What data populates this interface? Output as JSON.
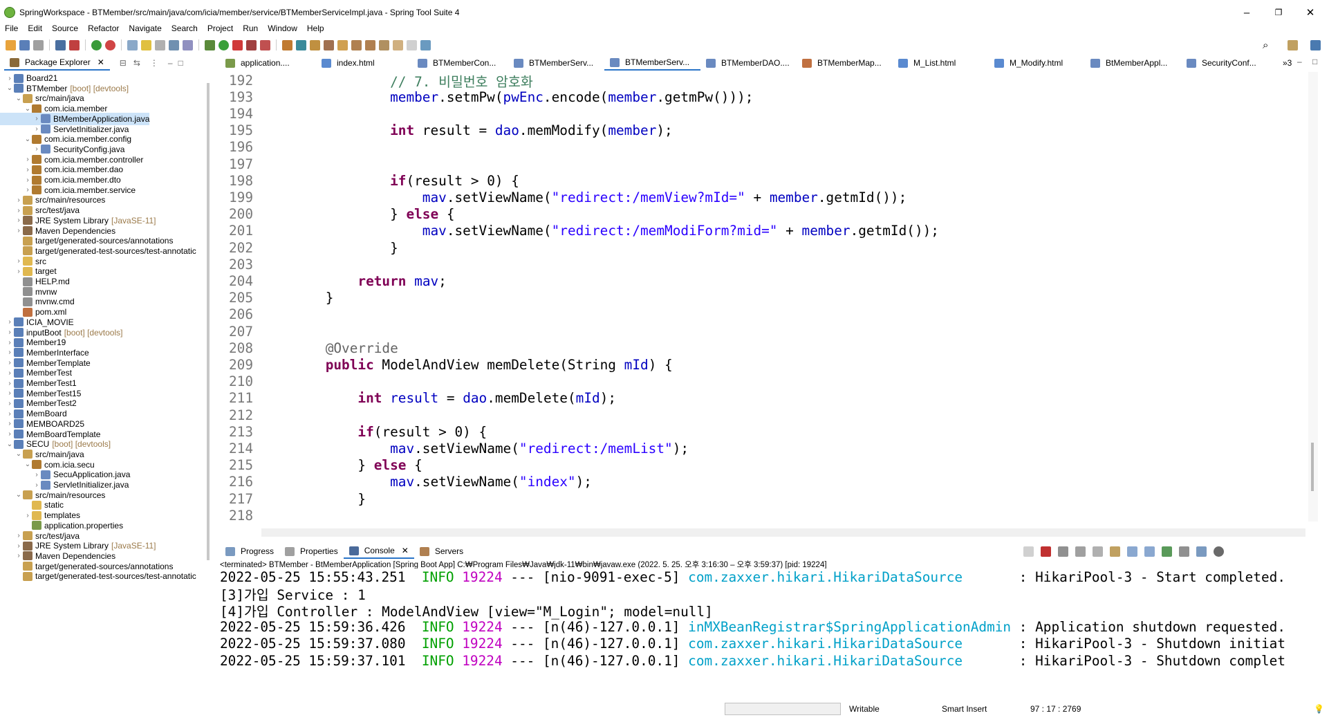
{
  "window": {
    "title": "SpringWorkspace - BTMember/src/main/java/com/icia/member/service/BTMemberServiceImpl.java - Spring Tool Suite 4",
    "minimize": "–",
    "maximize": "❐",
    "close": "✕"
  },
  "menu": [
    "File",
    "Edit",
    "Source",
    "Refactor",
    "Navigate",
    "Search",
    "Project",
    "Run",
    "Window",
    "Help"
  ],
  "package_explorer": {
    "tab_label": "Package Explorer",
    "items": [
      {
        "label": "Board21",
        "dec": "",
        "depth": 0,
        "arrow": "›",
        "icon": "project"
      },
      {
        "label": "BTMember",
        "dec": "[boot] [devtools]",
        "depth": 0,
        "arrow": "⌄",
        "icon": "project"
      },
      {
        "label": "src/main/java",
        "dec": "",
        "depth": 1,
        "arrow": "⌄",
        "icon": "srcfolder"
      },
      {
        "label": "com.icia.member",
        "dec": "",
        "depth": 2,
        "arrow": "⌄",
        "icon": "package"
      },
      {
        "label": "BtMemberApplication.java",
        "dec": "",
        "depth": 3,
        "arrow": "›",
        "icon": "java",
        "selected": true
      },
      {
        "label": "ServletInitializer.java",
        "dec": "",
        "depth": 3,
        "arrow": "›",
        "icon": "java"
      },
      {
        "label": "com.icia.member.config",
        "dec": "",
        "depth": 2,
        "arrow": "⌄",
        "icon": "package"
      },
      {
        "label": "SecurityConfig.java",
        "dec": "",
        "depth": 3,
        "arrow": "›",
        "icon": "java"
      },
      {
        "label": "com.icia.member.controller",
        "dec": "",
        "depth": 2,
        "arrow": "›",
        "icon": "package"
      },
      {
        "label": "com.icia.member.dao",
        "dec": "",
        "depth": 2,
        "arrow": "›",
        "icon": "package"
      },
      {
        "label": "com.icia.member.dto",
        "dec": "",
        "depth": 2,
        "arrow": "›",
        "icon": "package"
      },
      {
        "label": "com.icia.member.service",
        "dec": "",
        "depth": 2,
        "arrow": "›",
        "icon": "package"
      },
      {
        "label": "src/main/resources",
        "dec": "",
        "depth": 1,
        "arrow": "›",
        "icon": "srcfolder"
      },
      {
        "label": "src/test/java",
        "dec": "",
        "depth": 1,
        "arrow": "›",
        "icon": "srcfolder"
      },
      {
        "label": "JRE System Library",
        "dec": "[JavaSE-11]",
        "depth": 1,
        "arrow": "›",
        "icon": "lib"
      },
      {
        "label": "Maven Dependencies",
        "dec": "",
        "depth": 1,
        "arrow": "›",
        "icon": "lib"
      },
      {
        "label": "target/generated-sources/annotations",
        "dec": "",
        "depth": 1,
        "arrow": "",
        "icon": "srcfolder"
      },
      {
        "label": "target/generated-test-sources/test-annotatic",
        "dec": "",
        "depth": 1,
        "arrow": "",
        "icon": "srcfolder"
      },
      {
        "label": "src",
        "dec": "",
        "depth": 1,
        "arrow": "›",
        "icon": "folder"
      },
      {
        "label": "target",
        "dec": "",
        "depth": 1,
        "arrow": "›",
        "icon": "folder"
      },
      {
        "label": "HELP.md",
        "dec": "",
        "depth": 1,
        "arrow": "",
        "icon": "file"
      },
      {
        "label": "mvnw",
        "dec": "",
        "depth": 1,
        "arrow": "",
        "icon": "file"
      },
      {
        "label": "mvnw.cmd",
        "dec": "",
        "depth": 1,
        "arrow": "",
        "icon": "file"
      },
      {
        "label": "pom.xml",
        "dec": "",
        "depth": 1,
        "arrow": "",
        "icon": "xml"
      },
      {
        "label": "ICIA_MOVIE",
        "dec": "",
        "depth": 0,
        "arrow": "›",
        "icon": "project"
      },
      {
        "label": "inputBoot",
        "dec": "[boot] [devtools]",
        "depth": 0,
        "arrow": "›",
        "icon": "project"
      },
      {
        "label": "Member19",
        "dec": "",
        "depth": 0,
        "arrow": "›",
        "icon": "project"
      },
      {
        "label": "MemberInterface",
        "dec": "",
        "depth": 0,
        "arrow": "›",
        "icon": "project"
      },
      {
        "label": "MemberTemplate",
        "dec": "",
        "depth": 0,
        "arrow": "›",
        "icon": "project"
      },
      {
        "label": "MemberTest",
        "dec": "",
        "depth": 0,
        "arrow": "›",
        "icon": "project"
      },
      {
        "label": "MemberTest1",
        "dec": "",
        "depth": 0,
        "arrow": "›",
        "icon": "project"
      },
      {
        "label": "MemberTest15",
        "dec": "",
        "depth": 0,
        "arrow": "›",
        "icon": "project"
      },
      {
        "label": "MemberTest2",
        "dec": "",
        "depth": 0,
        "arrow": "›",
        "icon": "project"
      },
      {
        "label": "MemBoard",
        "dec": "",
        "depth": 0,
        "arrow": "›",
        "icon": "project"
      },
      {
        "label": "MEMBOARD25",
        "dec": "",
        "depth": 0,
        "arrow": "›",
        "icon": "project"
      },
      {
        "label": "MemBoardTemplate",
        "dec": "",
        "depth": 0,
        "arrow": "›",
        "icon": "project"
      },
      {
        "label": "SECU",
        "dec": "[boot] [devtools]",
        "depth": 0,
        "arrow": "⌄",
        "icon": "project"
      },
      {
        "label": "src/main/java",
        "dec": "",
        "depth": 1,
        "arrow": "⌄",
        "icon": "srcfolder"
      },
      {
        "label": "com.icia.secu",
        "dec": "",
        "depth": 2,
        "arrow": "⌄",
        "icon": "package"
      },
      {
        "label": "SecuApplication.java",
        "dec": "",
        "depth": 3,
        "arrow": "›",
        "icon": "java"
      },
      {
        "label": "ServletInitializer.java",
        "dec": "",
        "depth": 3,
        "arrow": "›",
        "icon": "java"
      },
      {
        "label": "src/main/resources",
        "dec": "",
        "depth": 1,
        "arrow": "⌄",
        "icon": "srcfolder"
      },
      {
        "label": "static",
        "dec": "",
        "depth": 2,
        "arrow": "",
        "icon": "folder"
      },
      {
        "label": "templates",
        "dec": "",
        "depth": 2,
        "arrow": "›",
        "icon": "folder"
      },
      {
        "label": "application.properties",
        "dec": "",
        "depth": 2,
        "arrow": "",
        "icon": "props"
      },
      {
        "label": "src/test/java",
        "dec": "",
        "depth": 1,
        "arrow": "›",
        "icon": "srcfolder"
      },
      {
        "label": "JRE System Library",
        "dec": "[JavaSE-11]",
        "depth": 1,
        "arrow": "›",
        "icon": "lib"
      },
      {
        "label": "Maven Dependencies",
        "dec": "",
        "depth": 1,
        "arrow": "›",
        "icon": "lib"
      },
      {
        "label": "target/generated-sources/annotations",
        "dec": "",
        "depth": 1,
        "arrow": "",
        "icon": "srcfolder"
      },
      {
        "label": "target/generated-test-sources/test-annotatic",
        "dec": "",
        "depth": 1,
        "arrow": "",
        "icon": "srcfolder"
      }
    ]
  },
  "editor_tabs": [
    {
      "label": "application....",
      "icon": "props"
    },
    {
      "label": "index.html",
      "icon": "html"
    },
    {
      "label": "BTMemberCon...",
      "icon": "java"
    },
    {
      "label": "BTMemberServ...",
      "icon": "java"
    },
    {
      "label": "BTMemberServ...",
      "icon": "java",
      "active": true
    },
    {
      "label": "BTMemberDAO....",
      "icon": "java"
    },
    {
      "label": "BTMemberMap...",
      "icon": "xml"
    },
    {
      "label": "M_List.html",
      "icon": "html"
    },
    {
      "label": "M_Modify.html",
      "icon": "html"
    },
    {
      "label": "BtMemberAppl...",
      "icon": "java"
    },
    {
      "label": "SecurityConf...",
      "icon": "java"
    },
    {
      "label": "»3",
      "icon": ""
    }
  ],
  "code": [
    {
      "n": "192",
      "segs": [
        [
          "            ",
          ""
        ],
        [
          "// 7. 비밀번호 암호화",
          "cmt"
        ]
      ]
    },
    {
      "n": "193",
      "segs": [
        [
          "            ",
          ""
        ],
        [
          "member",
          "fld"
        ],
        [
          ".setmPw(",
          ""
        ],
        [
          "pwEnc",
          "fld"
        ],
        [
          ".encode(",
          ""
        ],
        [
          "member",
          "fld"
        ],
        [
          ".getmPw()));",
          ""
        ]
      ]
    },
    {
      "n": "194",
      "segs": []
    },
    {
      "n": "195",
      "segs": [
        [
          "            ",
          ""
        ],
        [
          "int",
          "kw"
        ],
        [
          " result = ",
          ""
        ],
        [
          "dao",
          "fld"
        ],
        [
          ".memModify(",
          ""
        ],
        [
          "member",
          "fld"
        ],
        [
          ");",
          ""
        ]
      ]
    },
    {
      "n": "196",
      "segs": []
    },
    {
      "n": "197",
      "segs": []
    },
    {
      "n": "198",
      "segs": [
        [
          "            ",
          ""
        ],
        [
          "if",
          "kw"
        ],
        [
          "(result > 0) {",
          ""
        ]
      ]
    },
    {
      "n": "199",
      "segs": [
        [
          "                ",
          ""
        ],
        [
          "mav",
          "fld"
        ],
        [
          ".setViewName(",
          ""
        ],
        [
          "\"redirect:/memView?mId=\"",
          "str"
        ],
        [
          " + ",
          ""
        ],
        [
          "member",
          "fld"
        ],
        [
          ".getmId());",
          ""
        ]
      ]
    },
    {
      "n": "200",
      "segs": [
        [
          "            } ",
          ""
        ],
        [
          "else",
          "kw"
        ],
        [
          " {",
          ""
        ]
      ]
    },
    {
      "n": "201",
      "segs": [
        [
          "                ",
          ""
        ],
        [
          "mav",
          "fld"
        ],
        [
          ".setViewName(",
          ""
        ],
        [
          "\"redirect:/memModiForm?mid=\"",
          "str"
        ],
        [
          " + ",
          ""
        ],
        [
          "member",
          "fld"
        ],
        [
          ".getmId());",
          ""
        ]
      ]
    },
    {
      "n": "202",
      "segs": [
        [
          "            }",
          ""
        ]
      ]
    },
    {
      "n": "203",
      "segs": []
    },
    {
      "n": "204",
      "segs": [
        [
          "        ",
          ""
        ],
        [
          "return",
          "kw"
        ],
        [
          " ",
          ""
        ],
        [
          "mav",
          "fld"
        ],
        [
          ";",
          ""
        ]
      ]
    },
    {
      "n": "205",
      "segs": [
        [
          "    }",
          ""
        ]
      ]
    },
    {
      "n": "206",
      "segs": []
    },
    {
      "n": "207",
      "segs": []
    },
    {
      "n": "208",
      "segs": [
        [
          "    ",
          ""
        ],
        [
          "@Override",
          "ann"
        ]
      ]
    },
    {
      "n": "209",
      "segs": [
        [
          "    ",
          ""
        ],
        [
          "public",
          "kw"
        ],
        [
          " ModelAndView memDelete(String ",
          ""
        ],
        [
          "mId",
          "fld"
        ],
        [
          ") {",
          ""
        ]
      ]
    },
    {
      "n": "210",
      "segs": []
    },
    {
      "n": "211",
      "segs": [
        [
          "        ",
          ""
        ],
        [
          "int",
          "kw"
        ],
        [
          " ",
          ""
        ],
        [
          "result",
          "fld"
        ],
        [
          " = ",
          ""
        ],
        [
          "dao",
          "fld"
        ],
        [
          ".memDelete(",
          ""
        ],
        [
          "mId",
          "fld"
        ],
        [
          ");",
          ""
        ]
      ]
    },
    {
      "n": "212",
      "segs": []
    },
    {
      "n": "213",
      "segs": [
        [
          "        ",
          ""
        ],
        [
          "if",
          "kw"
        ],
        [
          "(result > 0) {",
          ""
        ]
      ]
    },
    {
      "n": "214",
      "segs": [
        [
          "            ",
          ""
        ],
        [
          "mav",
          "fld"
        ],
        [
          ".setViewName(",
          ""
        ],
        [
          "\"redirect:/memList\"",
          "str"
        ],
        [
          ");",
          ""
        ]
      ]
    },
    {
      "n": "215",
      "segs": [
        [
          "        } ",
          ""
        ],
        [
          "else",
          "kw"
        ],
        [
          " {",
          ""
        ]
      ]
    },
    {
      "n": "216",
      "segs": [
        [
          "            ",
          ""
        ],
        [
          "mav",
          "fld"
        ],
        [
          ".setViewName(",
          ""
        ],
        [
          "\"index\"",
          "str"
        ],
        [
          ");",
          ""
        ]
      ]
    },
    {
      "n": "217",
      "segs": [
        [
          "        }",
          ""
        ]
      ]
    },
    {
      "n": "218",
      "segs": []
    }
  ],
  "bottom_tabs": [
    "Progress",
    "Properties",
    "Console",
    "Servers"
  ],
  "console": {
    "header": "<terminated> BTMember - BtMemberApplication [Spring Boot App] C:₩Program Files₩Java₩jdk-11₩bin₩javaw.exe  (2022. 5. 25. 오후 3:16:30 – 오후 3:59:37) [pid: 19224]",
    "lines": [
      [
        [
          "2022-05-25 15:55:43.251  ",
          ""
        ],
        [
          "INFO",
          "info"
        ],
        [
          " ",
          ""
        ],
        [
          "19224",
          "pid"
        ],
        [
          " --- [nio-9091-exec-5] ",
          ""
        ],
        [
          "com.zaxxer.hikari.HikariDataSource",
          "lg"
        ],
        [
          "       : HikariPool-3 - Start completed.",
          ""
        ]
      ],
      [
        [
          "[3]가입 Service : 1",
          ""
        ]
      ],
      [
        [
          "[4]가입 Controller : ModelAndView [view=\"M_Login\"; model=null]",
          ""
        ]
      ],
      [
        [
          "2022-05-25 15:59:36.426  ",
          ""
        ],
        [
          "INFO",
          "info"
        ],
        [
          " ",
          ""
        ],
        [
          "19224",
          "pid"
        ],
        [
          " --- [n(46)-127.0.0.1] ",
          ""
        ],
        [
          "inMXBeanRegistrar$SpringApplicationAdmin",
          "lg"
        ],
        [
          " : Application shutdown requested.",
          ""
        ]
      ],
      [
        [
          "2022-05-25 15:59:37.080  ",
          ""
        ],
        [
          "INFO",
          "info"
        ],
        [
          " ",
          ""
        ],
        [
          "19224",
          "pid"
        ],
        [
          " --- [n(46)-127.0.0.1] ",
          ""
        ],
        [
          "com.zaxxer.hikari.HikariDataSource",
          "lg"
        ],
        [
          "       : HikariPool-3 - Shutdown initiat",
          ""
        ]
      ],
      [
        [
          "2022-05-25 15:59:37.101  ",
          ""
        ],
        [
          "INFO",
          "info"
        ],
        [
          " ",
          ""
        ],
        [
          "19224",
          "pid"
        ],
        [
          " --- [n(46)-127.0.0.1] ",
          ""
        ],
        [
          "com.zaxxer.hikari.HikariDataSource",
          "lg"
        ],
        [
          "       : HikariPool-3 - Shutdown complet",
          ""
        ]
      ]
    ]
  },
  "status": {
    "writable": "Writable",
    "insert": "Smart Insert",
    "position": "97 : 17 : 2769"
  },
  "colors": {
    "keyword": "#7f0055",
    "string": "#2a00ff",
    "field": "#0000c0",
    "comment": "#3f7f5f",
    "selection": "#cce3f8"
  }
}
